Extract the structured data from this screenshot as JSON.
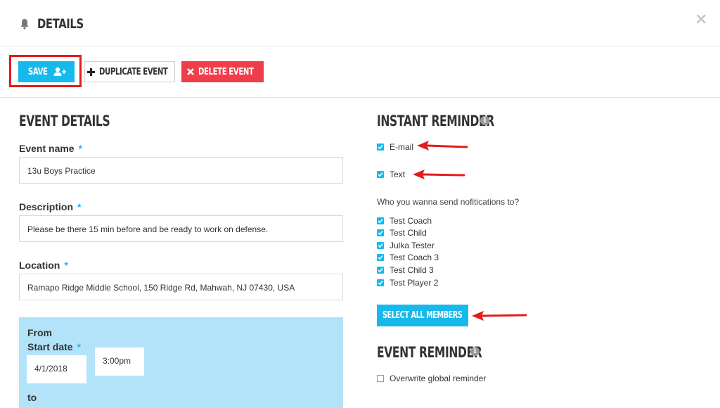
{
  "header": {
    "title": "Details"
  },
  "toolbar": {
    "save_label": "Save",
    "duplicate_label": "Duplicate Event",
    "delete_label": "Delete Event"
  },
  "event_details": {
    "title": "Event Details",
    "name_label": "Event name",
    "name_value": "13u Boys Practice",
    "description_label": "Description",
    "description_value": "Please be there 15 min before and be ready to work on defense.",
    "location_label": "Location",
    "location_value": "Ramapo Ridge Middle School, 150 Ridge Rd, Mahwah, NJ 07430, USA",
    "required_mark": "*",
    "from_label": "From",
    "start_date_label": "Start date",
    "start_date_value": "4/1/2018",
    "start_time_value": "3:00pm",
    "to_label": "to"
  },
  "instant_reminder": {
    "title": "Instant Reminder",
    "email_label": "E-mail",
    "email_checked": true,
    "text_label": "Text",
    "text_checked": true,
    "recipients_question": "Who you wanna send nofitications to?",
    "members": [
      {
        "name": "Test Coach",
        "checked": true
      },
      {
        "name": "Test Child",
        "checked": true
      },
      {
        "name": "Julka Tester",
        "checked": true
      },
      {
        "name": "Test Coach 3",
        "checked": true
      },
      {
        "name": "Test Child 3",
        "checked": true
      },
      {
        "name": "Test Player 2",
        "checked": true
      }
    ],
    "select_all_label": "Select All Members"
  },
  "event_reminder": {
    "title": "Event Reminder",
    "overwrite_label": "Overwrite global reminder",
    "overwrite_checked": false
  },
  "colors": {
    "accent": "#16b9ec",
    "danger": "#ef3e4a",
    "annotation": "#e21c1c",
    "date_panel": "#b3e3f9"
  }
}
